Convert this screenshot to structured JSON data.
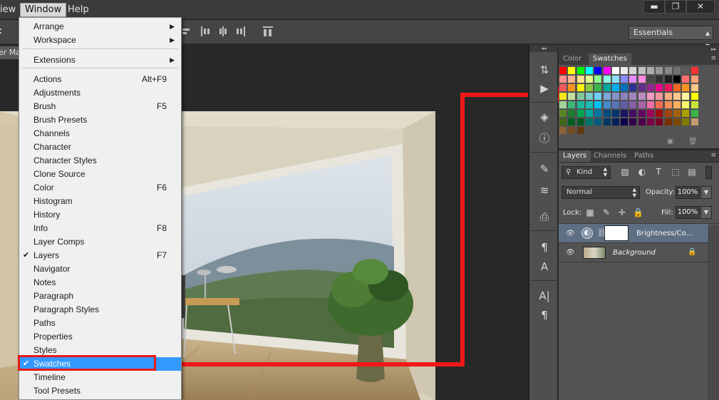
{
  "menubar": {
    "items": [
      "iew",
      "Window",
      "Help"
    ],
    "window_controls": {
      "minimize": "▬",
      "restore": "❐",
      "close": "✕"
    }
  },
  "options_bar": {
    "workspace": "Essentials"
  },
  "document": {
    "tab_label": "er Ma"
  },
  "window_menu": {
    "items": [
      {
        "label": "Arrange",
        "submenu": true
      },
      {
        "label": "Workspace",
        "submenu": true
      },
      {
        "label": "Extensions",
        "submenu": true
      },
      {
        "label": "Actions",
        "shortcut": "Alt+F9"
      },
      {
        "label": "Adjustments"
      },
      {
        "label": "Brush",
        "shortcut": "F5"
      },
      {
        "label": "Brush Presets"
      },
      {
        "label": "Channels"
      },
      {
        "label": "Character"
      },
      {
        "label": "Character Styles"
      },
      {
        "label": "Clone Source"
      },
      {
        "label": "Color",
        "shortcut": "F6"
      },
      {
        "label": "Histogram"
      },
      {
        "label": "History"
      },
      {
        "label": "Info",
        "shortcut": "F8"
      },
      {
        "label": "Layer Comps"
      },
      {
        "label": "Layers",
        "shortcut": "F7",
        "checked": true
      },
      {
        "label": "Navigator"
      },
      {
        "label": "Notes"
      },
      {
        "label": "Paragraph"
      },
      {
        "label": "Paragraph Styles"
      },
      {
        "label": "Paths"
      },
      {
        "label": "Properties"
      },
      {
        "label": "Styles"
      },
      {
        "label": "Swatches",
        "checked": true,
        "selected": true
      },
      {
        "label": "Timeline"
      },
      {
        "label": "Tool Presets"
      }
    ],
    "submenu_glyph": "▶",
    "check_glyph": "✔"
  },
  "color_panel": {
    "tabs": [
      "Color",
      "Swatches"
    ],
    "active_tab": "Swatches",
    "swatch_rows": [
      [
        "#ff0000",
        "#ffff00",
        "#00ff00",
        "#00ffff",
        "#0000ff",
        "#ff00ff",
        "#ffffff",
        "#ebebeb",
        "#d6d6d6",
        "#c2c2c2",
        "#adadad",
        "#999999",
        "#858585",
        "#707070",
        "#5c5c5c",
        "#ff3333"
      ],
      [
        "#ff8c8c",
        "#ffb38c",
        "#ffe08c",
        "#e0ff8c",
        "#8cff8c",
        "#8cffe0",
        "#8ce0ff",
        "#8c8cff",
        "#e08cff",
        "#ff8ce0",
        "#474747",
        "#333333",
        "#1f1f1f",
        "#000000",
        "#ff6f6f",
        "#ffa07a"
      ],
      [
        "#f25a5a",
        "#f7941d",
        "#fff200",
        "#8dc63f",
        "#39b54a",
        "#00a99d",
        "#00aeef",
        "#0072bc",
        "#2e3192",
        "#662d91",
        "#92278f",
        "#ec008c",
        "#ed145b",
        "#f26522",
        "#f7941d",
        "#fdc689"
      ],
      [
        "#f8e71c",
        "#c4df9b",
        "#82ca9c",
        "#7accc8",
        "#6dcff6",
        "#7da7d9",
        "#8393ca",
        "#8781bd",
        "#a186be",
        "#bd8cbf",
        "#f49ac1",
        "#f6989d",
        "#f9ad81",
        "#fdc68a",
        "#fff799",
        "#ffff00"
      ],
      [
        "#a3d39c",
        "#3cb878",
        "#1abc9c",
        "#1cbbb4",
        "#00bff3",
        "#448ccb",
        "#5674b9",
        "#605ca8",
        "#855fa8",
        "#a864a8",
        "#f06eaa",
        "#f26c4f",
        "#f68e56",
        "#fbaf5d",
        "#fff568",
        "#c8e637"
      ],
      [
        "#598527",
        "#197b30",
        "#00a651",
        "#00a99d",
        "#0076a3",
        "#004a80",
        "#003471",
        "#1b1464",
        "#440e62",
        "#630460",
        "#9e005d",
        "#9e0b0f",
        "#a0410d",
        "#a36209",
        "#aba000",
        "#39b54a"
      ],
      [
        "#406618",
        "#005e20",
        "#005826",
        "#00746b",
        "#005b7f",
        "#003663",
        "#002157",
        "#0d004c",
        "#32004b",
        "#4b0049",
        "#7b0046",
        "#7a0026",
        "#7b2e00",
        "#7d4900",
        "#827b00",
        "#c69c6d"
      ],
      [
        "#8c6239",
        "#754c24",
        "#603913"
      ]
    ],
    "footer_icons": [
      "new-swatch-icon",
      "trash-icon"
    ]
  },
  "layers_panel": {
    "tabs": [
      "Layers",
      "Channels",
      "Paths"
    ],
    "active_tab": "Layers",
    "filter_kind": "Kind",
    "blend_mode": "Normal",
    "opacity_label": "Opacity:",
    "opacity_value": "100%",
    "lock_label": "Lock:",
    "fill_label": "Fill:",
    "fill_value": "100%",
    "layers": [
      {
        "name": "Brightness/Co...",
        "italic": false,
        "active": true
      },
      {
        "name": "Background",
        "italic": true,
        "active": false
      }
    ]
  }
}
